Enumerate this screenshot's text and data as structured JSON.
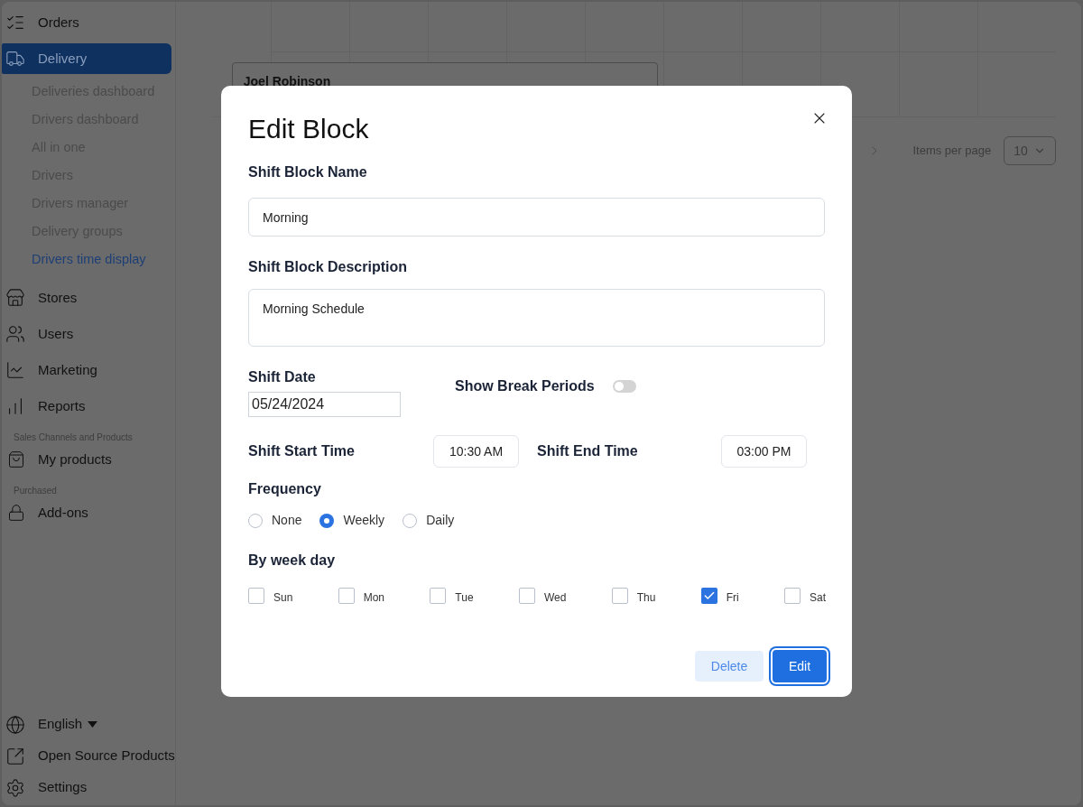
{
  "sidebar": {
    "nav": [
      {
        "label": "Orders",
        "selected": false
      },
      {
        "label": "Delivery",
        "selected": true,
        "children": [
          {
            "label": "Deliveries dashboard",
            "selected": false
          },
          {
            "label": "Drivers dashboard",
            "selected": false
          },
          {
            "label": "All in one",
            "selected": false
          },
          {
            "label": "Drivers",
            "selected": false
          },
          {
            "label": "Drivers manager",
            "selected": false
          },
          {
            "label": "Delivery groups",
            "selected": false
          },
          {
            "label": "Drivers time display",
            "selected": true
          }
        ]
      },
      {
        "label": "Stores",
        "selected": false
      },
      {
        "label": "Users",
        "selected": false
      },
      {
        "label": "Marketing",
        "selected": false
      },
      {
        "label": "Reports",
        "selected": false
      }
    ],
    "sections": [
      {
        "heading": "Sales Channels and Products",
        "items": [
          {
            "label": "My products",
            "selected": false
          }
        ]
      },
      {
        "heading": "Purchased",
        "items": [
          {
            "label": "Add-ons",
            "selected": false
          }
        ]
      }
    ],
    "language": "English",
    "footer": [
      {
        "label": "Open Source Products"
      },
      {
        "label": "Settings"
      }
    ]
  },
  "background": {
    "card_name": "Joel Robinson",
    "items_per_page_label": "Items per page",
    "page_size": "10"
  },
  "dialog": {
    "title": "Edit Block",
    "name_label": "Shift Block Name",
    "name_value": "Morning",
    "description_label": "Shift Block Description",
    "description_value": "Morning Schedule",
    "date_label": "Shift Date",
    "date_value": "05/24/2024",
    "break_label": "Show Break Periods",
    "break_on": false,
    "start_label": "Shift Start Time",
    "start_value": "10:30 AM",
    "end_label": "Shift End Time",
    "end_value": "03:00 PM",
    "frequency_label": "Frequency",
    "frequency": [
      {
        "label": "None",
        "selected": false
      },
      {
        "label": "Weekly",
        "selected": true
      },
      {
        "label": "Daily",
        "selected": false
      }
    ],
    "weekday_label": "By week day",
    "weekdays": [
      {
        "label": "Sun",
        "checked": false
      },
      {
        "label": "Mon",
        "checked": false
      },
      {
        "label": "Tue",
        "checked": false
      },
      {
        "label": "Wed",
        "checked": false
      },
      {
        "label": "Thu",
        "checked": false
      },
      {
        "label": "Fri",
        "checked": true
      },
      {
        "label": "Sat",
        "checked": false
      }
    ],
    "delete_button": "Delete",
    "edit_button": "Edit"
  }
}
